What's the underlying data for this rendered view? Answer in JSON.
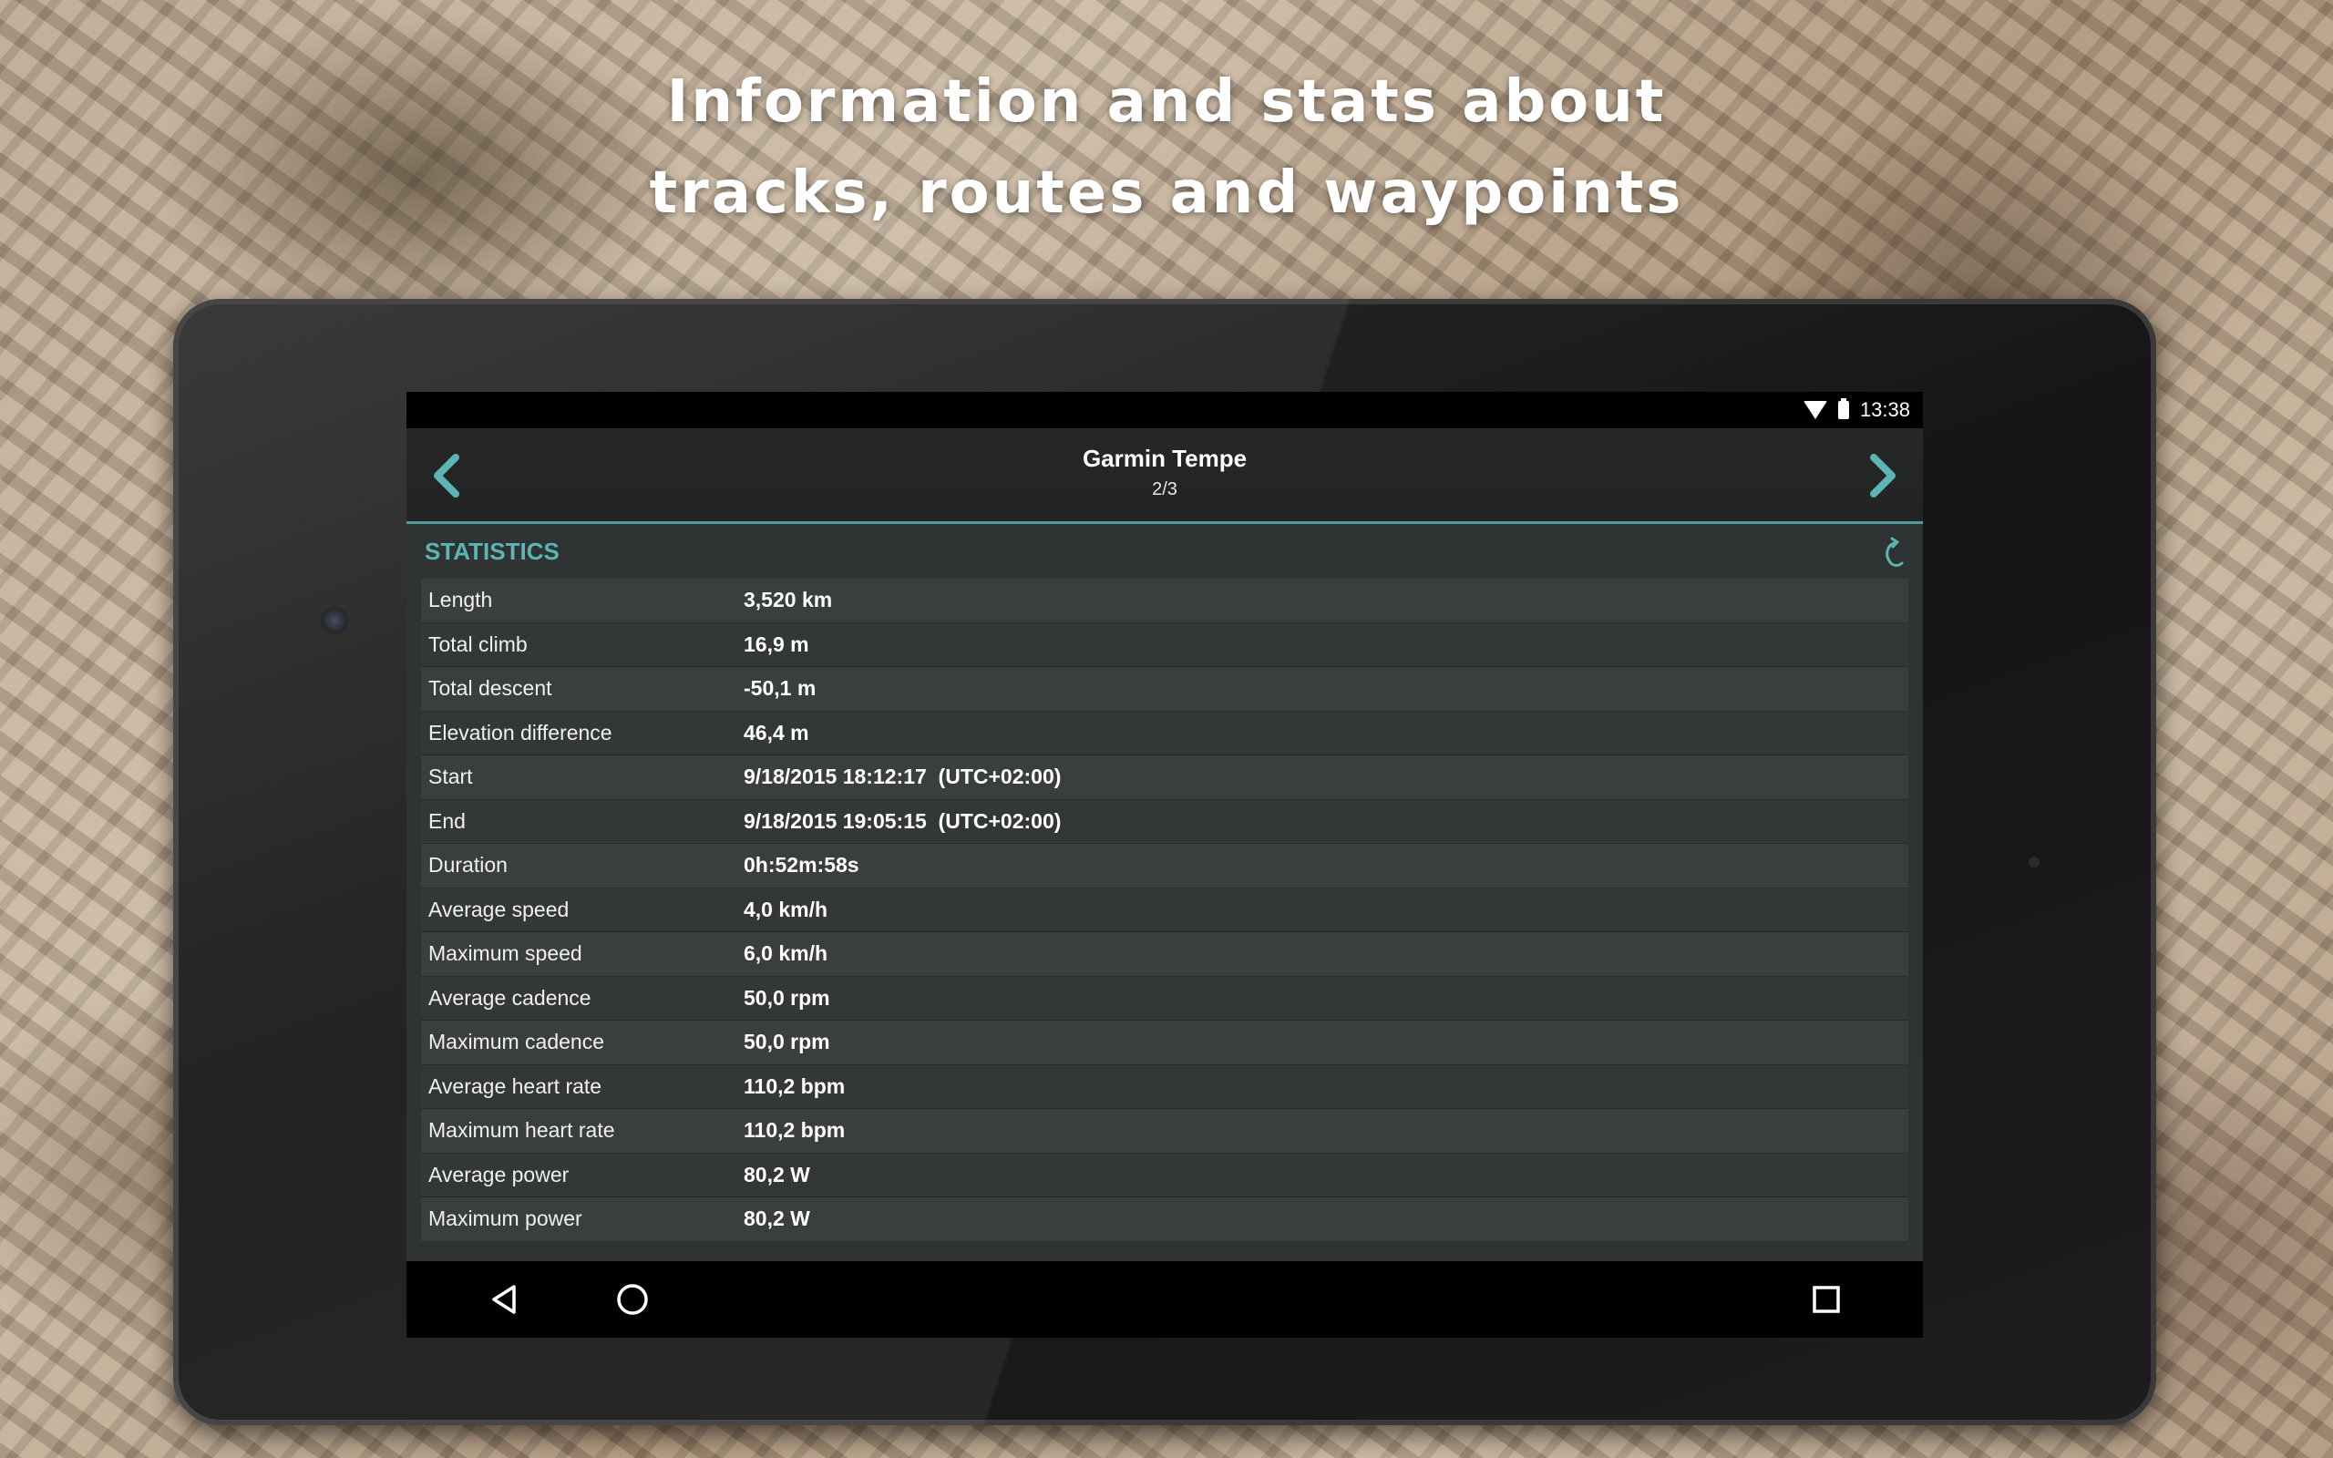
{
  "headline": {
    "line1": "Information and stats about",
    "line2": "tracks, routes and waypoints"
  },
  "status_bar": {
    "time": "13:38",
    "icons": [
      "wifi-icon",
      "battery-icon"
    ]
  },
  "toolbar": {
    "title": "Garmin Tempe",
    "subtitle": "2/3",
    "prev_icon": "chevron-left-icon",
    "next_icon": "chevron-right-icon"
  },
  "statistics": {
    "title": "STATISTICS",
    "action_icon": "refresh-icon",
    "rows": [
      {
        "label": "Length",
        "value": "3,520 km"
      },
      {
        "label": "Total climb",
        "value": "16,9 m"
      },
      {
        "label": "Total descent",
        "value": "-50,1 m"
      },
      {
        "label": "Elevation difference",
        "value": "46,4 m"
      },
      {
        "label": "Start",
        "value": "9/18/2015 18:12:17  (UTC+02:00)"
      },
      {
        "label": "End",
        "value": "9/18/2015 19:05:15  (UTC+02:00)"
      },
      {
        "label": "Duration",
        "value": "0h:52m:58s"
      },
      {
        "label": "Average speed",
        "value": "4,0 km/h"
      },
      {
        "label": "Maximum speed",
        "value": "6,0 km/h"
      },
      {
        "label": "Average cadence",
        "value": "50,0 rpm"
      },
      {
        "label": "Maximum cadence",
        "value": "50,0 rpm"
      },
      {
        "label": "Average heart rate",
        "value": "110,2 bpm"
      },
      {
        "label": "Maximum heart rate",
        "value": "110,2 bpm"
      },
      {
        "label": "Average power",
        "value": "80,2 W"
      },
      {
        "label": "Maximum power",
        "value": "80,2 W"
      }
    ]
  },
  "nav_bar": {
    "back_icon": "back-triangle-icon",
    "home_icon": "home-circle-icon",
    "recents_icon": "recents-square-icon"
  },
  "colors": {
    "accent": "#5ab5b4",
    "divider": "#4e9e9c",
    "screen_bg": "#303333"
  }
}
